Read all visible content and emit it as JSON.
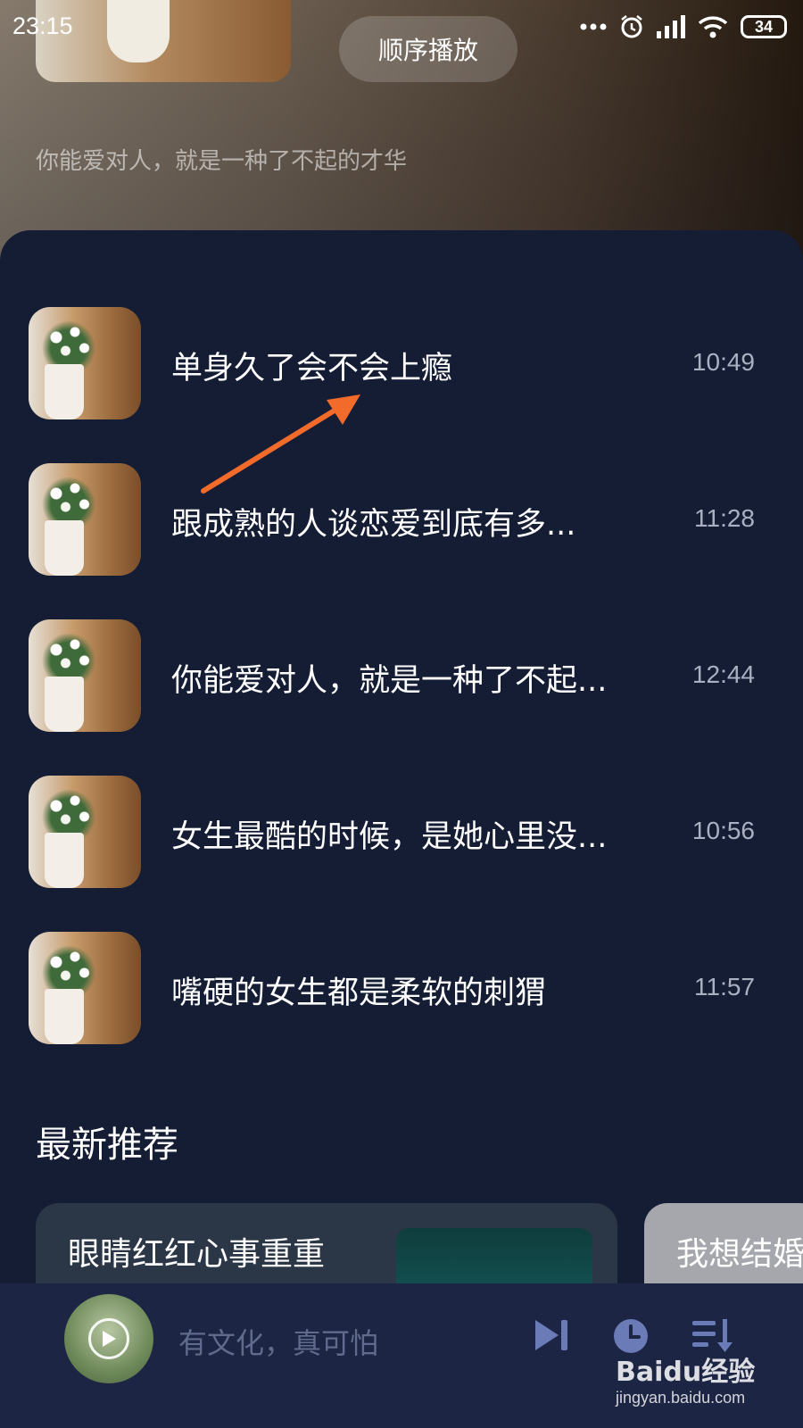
{
  "status_bar": {
    "time": "23:15",
    "battery": "34",
    "icons": [
      "more-dots-icon",
      "alarm-icon",
      "signal-icon",
      "wifi-icon",
      "battery-icon"
    ]
  },
  "header": {
    "play_order_label": "顺序播放",
    "album_description": "你能爱对人，就是一种了不起的才华"
  },
  "tracks": [
    {
      "title": "单身久了会不会上瘾",
      "duration": "10:49"
    },
    {
      "title": "跟成熟的人谈恋爱到底有多...",
      "duration": "11:28"
    },
    {
      "title": "你能爱对人，就是一种了不起...",
      "duration": "12:44"
    },
    {
      "title": "女生最酷的时候，是她心里没...",
      "duration": "10:56"
    },
    {
      "title": "嘴硬的女生都是柔软的刺猬",
      "duration": "11:57"
    }
  ],
  "recommend": {
    "section_title": "最新推荐",
    "cards": [
      {
        "label": "眼睛红红心事重重"
      },
      {
        "label": "我想结婚"
      }
    ]
  },
  "player": {
    "now_playing": "有文化，真可怕",
    "controls": [
      "next-track-icon",
      "timer-clock-icon",
      "playlist-icon"
    ]
  },
  "watermark": {
    "brand": "Baidu经验",
    "url": "jingyan.baidu.com"
  },
  "colors": {
    "panel_bg": "#151d35",
    "bottom_bar_bg": "#1c2543",
    "accent_arrow": "#f26b2a",
    "muted_text": "#a9b0c2"
  }
}
